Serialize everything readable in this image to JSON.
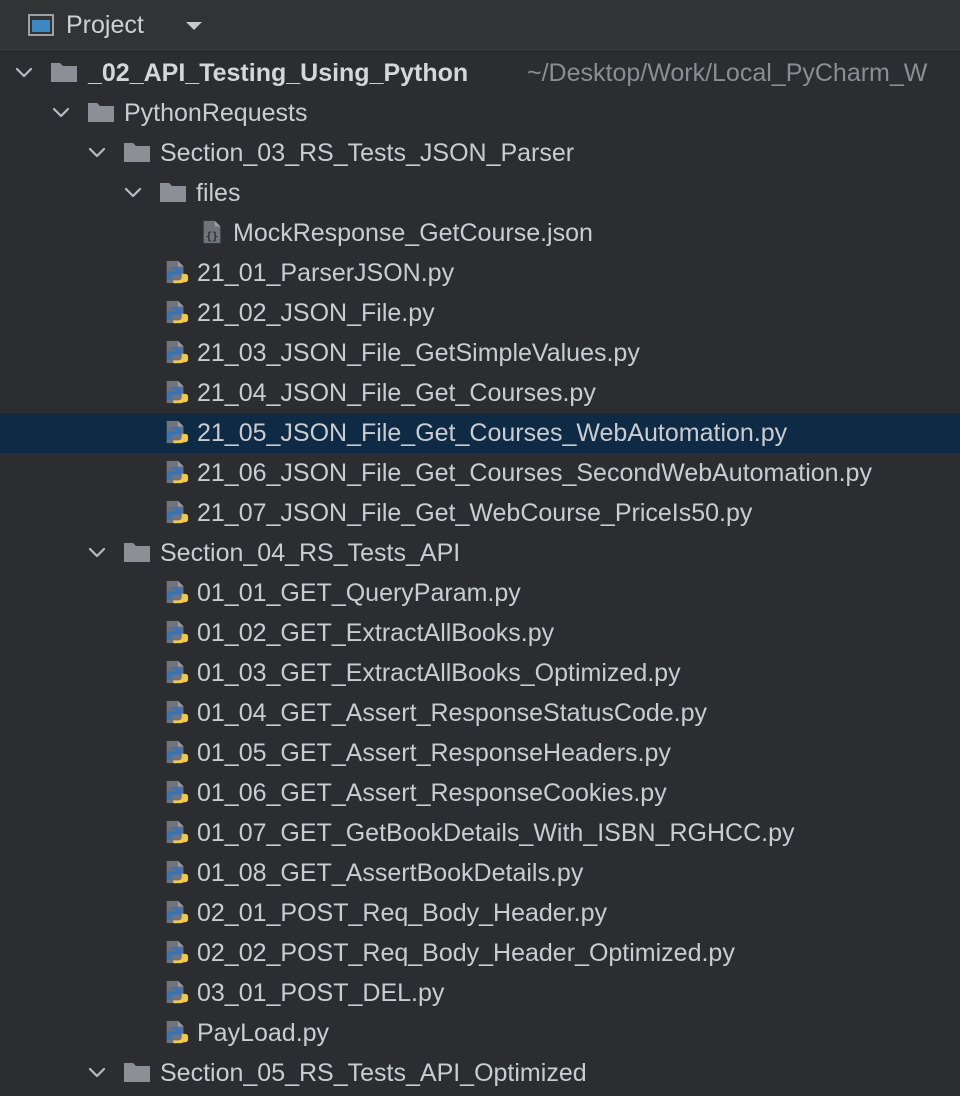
{
  "panel": {
    "title": "Project",
    "icon": "project-window-icon",
    "dropdown_icon": "chevron-down-icon"
  },
  "root": {
    "name": "_02_API_Testing_Using_Python",
    "path": "~/Desktop/Work/Local_PyCharm_W"
  },
  "folders": {
    "python_requests": "PythonRequests",
    "section_03": "Section_03_RS_Tests_JSON_Parser",
    "files": "files",
    "section_04": "Section_04_RS_Tests_API",
    "section_05": "Section_05_RS_Tests_API_Optimized"
  },
  "section_03_items": {
    "json_file": "MockResponse_GetCourse.json",
    "py": [
      "21_01_ParserJSON.py",
      "21_02_JSON_File.py",
      "21_03_JSON_File_GetSimpleValues.py",
      "21_04_JSON_File_Get_Courses.py",
      "21_05_JSON_File_Get_Courses_WebAutomation.py",
      "21_06_JSON_File_Get_Courses_SecondWebAutomation.py",
      "21_07_JSON_File_Get_WebCourse_PriceIs50.py"
    ]
  },
  "section_04_items": [
    "01_01_GET_QueryParam.py",
    "01_02_GET_ExtractAllBooks.py",
    "01_03_GET_ExtractAllBooks_Optimized.py",
    "01_04_GET_Assert_ResponseStatusCode.py",
    "01_05_GET_Assert_ResponseHeaders.py",
    "01_06_GET_Assert_ResponseCookies.py",
    "01_07_GET_GetBookDetails_With_ISBN_RGHCC.py",
    "01_08_GET_AssertBookDetails.py",
    "02_01_POST_Req_Body_Header.py",
    "02_02_POST_Req_Body_Header_Optimized.py",
    "03_01_POST_DEL.py",
    "PayLoad.py"
  ],
  "selected_file": "21_05_JSON_File_Get_Courses_WebAutomation.py",
  "colors": {
    "background": "#2b2d30",
    "selection": "#0e2a44",
    "text": "#c9ccd1",
    "path_text": "#8a8d92",
    "folder": "#8c9096",
    "python_blue": "#3b74b4",
    "python_yellow": "#f2c94c"
  }
}
